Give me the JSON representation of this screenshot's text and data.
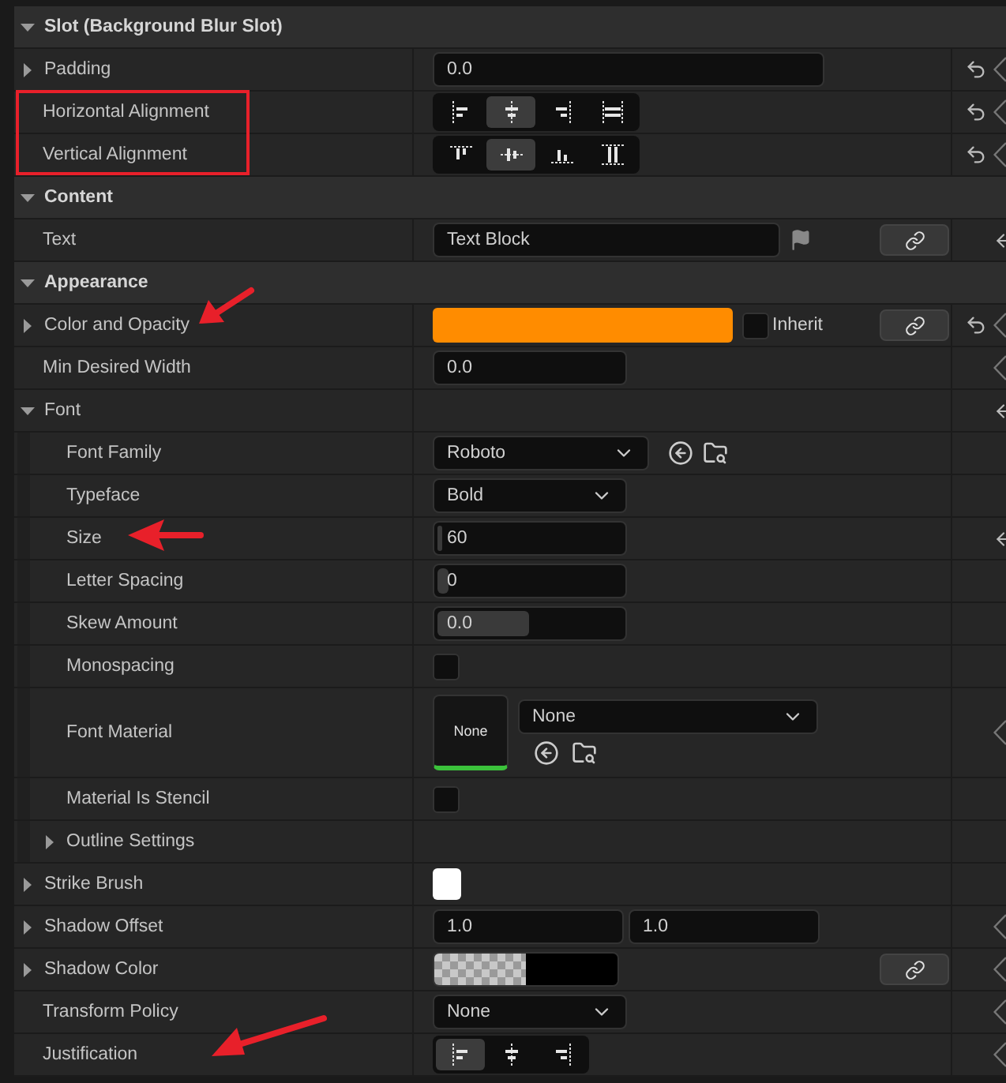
{
  "sections": [
    {
      "title": "Slot (Background Blur Slot)",
      "expanded": true,
      "rows": [
        {
          "label": "Padding",
          "expanded": false,
          "value": {
            "kind": "wide-number",
            "text": "0.0"
          },
          "side_icons": [
            {
              "kind": "reset"
            },
            {
              "kind": "keyframe"
            }
          ]
        },
        {
          "label": "Horizontal Alignment",
          "value": {
            "kind": "align",
            "options": [
              {
                "kind": "left",
                "selected": false
              },
              {
                "kind": "center",
                "selected": true
              },
              {
                "kind": "right",
                "selected": false
              },
              {
                "kind": "fill",
                "selected": false
              }
            ]
          },
          "side_icons": [
            {
              "kind": "reset"
            },
            {
              "kind": "keyframe"
            }
          ]
        },
        {
          "label": "Vertical Alignment",
          "value": {
            "kind": "align",
            "options": [
              {
                "kind": "top",
                "selected": false
              },
              {
                "kind": "middle",
                "selected": true
              },
              {
                "kind": "bottom",
                "selected": false
              },
              {
                "kind": "vfill",
                "selected": false
              }
            ]
          },
          "side_icons": [
            {
              "kind": "reset"
            },
            {
              "kind": "keyframe"
            }
          ]
        }
      ]
    },
    {
      "title": "Content",
      "expanded": true,
      "rows": [
        {
          "label": "Text",
          "value": {
            "kind": "text",
            "text": "Text Block"
          },
          "side_icons": [
            {
              "kind": "arrow"
            }
          ]
        }
      ]
    },
    {
      "title": "Appearance",
      "expanded": true,
      "rows": [
        {
          "label": "Color and Opacity",
          "expanded": false,
          "value": {
            "kind": "color",
            "color": "#ff8c00",
            "inherit": {
              "label": "Inherit",
              "checked": false
            }
          },
          "side_icons": [
            {
              "kind": "reset"
            },
            {
              "kind": "keyframe"
            }
          ]
        },
        {
          "label": "Min Desired Width",
          "value": {
            "kind": "number",
            "text": "0.0"
          },
          "side_icons": [
            {
              "kind": "keyframe"
            }
          ]
        },
        {
          "label": "Font",
          "expanded": true,
          "value": {
            "kind": "none"
          },
          "side_icons": [
            {
              "kind": "arrow"
            }
          ],
          "children": [
            {
              "label": "Font Family",
              "value": {
                "kind": "browse-dropdown",
                "text": "Roboto"
              }
            },
            {
              "label": "Typeface",
              "value": {
                "kind": "dropdown",
                "text": "Bold"
              }
            },
            {
              "label": "Size",
              "value": {
                "kind": "spin",
                "text": "60",
                "level": 0.02
              },
              "side_icons": [
                {
                  "kind": "arrow"
                }
              ]
            },
            {
              "label": "Letter Spacing",
              "value": {
                "kind": "spin",
                "text": "0",
                "level": 0.06
              }
            },
            {
              "label": "Skew Amount",
              "value": {
                "kind": "spin",
                "text": "0.0",
                "level": 0.48
              }
            },
            {
              "label": "Monospacing",
              "value": {
                "kind": "checkbox",
                "checked": false
              }
            },
            {
              "label": "Font Material",
              "value": {
                "kind": "material",
                "thumb": "None",
                "text": "None"
              },
              "side_icons": [
                {
                  "kind": "keyframe"
                }
              ]
            },
            {
              "label": "Material Is Stencil",
              "value": {
                "kind": "checkbox",
                "checked": false
              }
            },
            {
              "label": "Outline Settings",
              "expanded": false,
              "value": {
                "kind": "none"
              }
            }
          ]
        },
        {
          "label": "Strike Brush",
          "expanded": false,
          "value": {
            "kind": "swatch",
            "color": "#ffffff"
          }
        },
        {
          "label": "Shadow Offset",
          "expanded": false,
          "value": {
            "kind": "pair",
            "texts": [
              "1.0",
              "1.0"
            ]
          },
          "side_icons": [
            {
              "kind": "keyframe"
            }
          ]
        },
        {
          "label": "Shadow Color",
          "expanded": false,
          "value": {
            "kind": "shadow",
            "color": "#000000"
          },
          "side_icons": [
            {
              "kind": "keyframe"
            }
          ]
        },
        {
          "label": "Transform Policy",
          "value": {
            "kind": "dropdown",
            "text": "None"
          },
          "side_icons": [
            {
              "kind": "keyframe"
            }
          ]
        },
        {
          "label": "Justification",
          "value": {
            "kind": "align",
            "options": [
              {
                "kind": "left",
                "selected": true
              },
              {
                "kind": "center",
                "selected": false
              },
              {
                "kind": "right",
                "selected": false
              }
            ]
          },
          "side_icons": [
            {
              "kind": "keyframe"
            }
          ]
        }
      ]
    }
  ]
}
